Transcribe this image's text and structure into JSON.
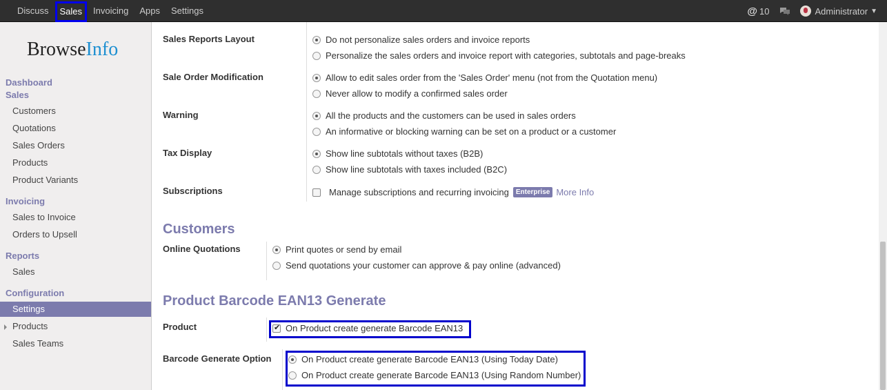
{
  "topbar": {
    "menu": [
      "Discuss",
      "Sales",
      "Invoicing",
      "Apps",
      "Settings"
    ],
    "active_index": 1,
    "mentions_count": "10",
    "user_name": "Administrator"
  },
  "sidebar": {
    "logo_part1": "Browse",
    "logo_part2": "Info",
    "dashboard": "Dashboard",
    "sales_head": "Sales",
    "sales_items": [
      "Customers",
      "Quotations",
      "Sales Orders",
      "Products",
      "Product Variants"
    ],
    "invoicing_head": "Invoicing",
    "invoicing_items": [
      "Sales to Invoice",
      "Orders to Upsell"
    ],
    "reports_head": "Reports",
    "reports_items": [
      "Sales"
    ],
    "configuration_head": "Configuration",
    "configuration_items": [
      "Settings",
      "Products",
      "Sales Teams"
    ]
  },
  "settings": {
    "sales_reports_layout": {
      "label": "Sales Reports Layout",
      "options": [
        "Do not personalize sales orders and invoice reports",
        "Personalize the sales orders and invoice report with categories, subtotals and page-breaks"
      ],
      "selected": 0
    },
    "sale_order_modification": {
      "label": "Sale Order Modification",
      "options": [
        "Allow to edit sales order from the 'Sales Order' menu (not from the Quotation menu)",
        "Never allow to modify a confirmed sales order"
      ],
      "selected": 0
    },
    "warning": {
      "label": "Warning",
      "options": [
        "All the products and the customers can be used in sales orders",
        "An informative or blocking warning can be set on a product or a customer"
      ],
      "selected": 0
    },
    "tax_display": {
      "label": "Tax Display",
      "options": [
        "Show line subtotals without taxes (B2B)",
        "Show line subtotals with taxes included (B2C)"
      ],
      "selected": 0
    },
    "subscriptions": {
      "label": "Subscriptions",
      "checkbox_label": "Manage subscriptions and recurring invoicing",
      "checked": false,
      "badge": "Enterprise",
      "more_info": "More Info"
    },
    "customers_title": "Customers",
    "online_quotations": {
      "label": "Online Quotations",
      "options": [
        "Print quotes or send by email",
        "Send quotations your customer can approve & pay online (advanced)"
      ],
      "selected": 0
    },
    "barcode_title": "Product Barcode EAN13 Generate",
    "product": {
      "label": "Product",
      "checkbox_label": "On Product create generate Barcode EAN13",
      "checked": true
    },
    "barcode_option": {
      "label": "Barcode Generate Option",
      "options": [
        "On Product create generate Barcode EAN13 (Using Today Date)",
        "On Product create generate Barcode EAN13 (Using Random Number)"
      ],
      "selected": 0
    }
  },
  "colors": {
    "accent": "#7c7bad",
    "highlight": "#0000cc",
    "topbar": "#2f2f2f"
  }
}
